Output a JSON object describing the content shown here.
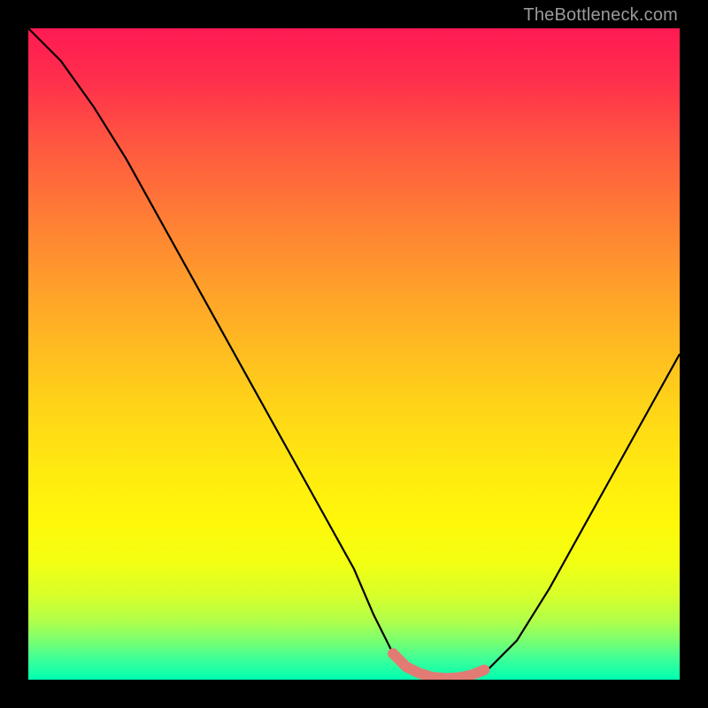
{
  "attribution": "TheBottleneck.com",
  "chart_data": {
    "type": "line",
    "title": "",
    "xlabel": "",
    "ylabel": "",
    "xlim": [
      0,
      100
    ],
    "ylim": [
      0,
      100
    ],
    "series": [
      {
        "name": "bottleneck-curve",
        "x": [
          0,
          5,
          10,
          15,
          20,
          25,
          30,
          35,
          40,
          45,
          50,
          53,
          56,
          60,
          63,
          66,
          70,
          75,
          80,
          85,
          90,
          95,
          100
        ],
        "values": [
          100,
          95,
          88,
          80,
          71,
          62,
          53,
          44,
          35,
          26,
          17,
          10,
          4,
          1,
          0,
          0,
          1,
          6,
          14,
          23,
          32,
          41,
          50
        ]
      }
    ],
    "highlight": {
      "name": "optimal-range",
      "x": [
        56,
        58,
        60,
        62,
        64,
        66,
        68,
        70
      ],
      "values": [
        4,
        2,
        1,
        0.4,
        0.2,
        0.3,
        0.7,
        1.5
      ]
    },
    "colors": {
      "curve": "#000000",
      "highlight": "#e27b74",
      "gradient_top": "#ff1a52",
      "gradient_bottom": "#00ffb0"
    }
  }
}
